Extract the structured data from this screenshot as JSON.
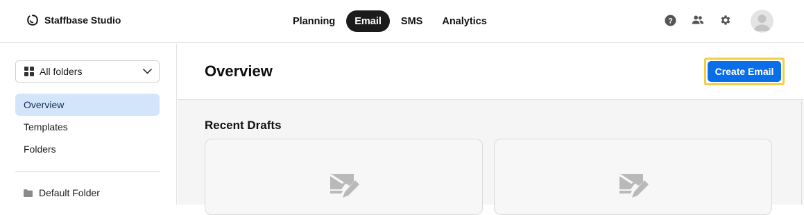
{
  "brand": {
    "name": "Staffbase Studio"
  },
  "nav": {
    "items": [
      {
        "label": "Planning",
        "active": false
      },
      {
        "label": "Email",
        "active": true
      },
      {
        "label": "SMS",
        "active": false
      },
      {
        "label": "Analytics",
        "active": false
      }
    ]
  },
  "top_icons": [
    "help-icon",
    "people-icon",
    "gear-icon"
  ],
  "sidebar": {
    "folder_select": {
      "label": "All folders"
    },
    "items": [
      {
        "label": "Overview",
        "active": true
      },
      {
        "label": "Templates",
        "active": false
      },
      {
        "label": "Folders",
        "active": false
      }
    ],
    "folders": [
      {
        "label": "Default Folder"
      }
    ]
  },
  "main": {
    "title": "Overview",
    "create_button": "Create Email",
    "recent_drafts": {
      "title": "Recent Drafts",
      "cards": [
        {
          "icon": "mail-edit-icon"
        },
        {
          "icon": "mail-edit-icon"
        }
      ]
    }
  },
  "colors": {
    "accent": "#0a6ee9",
    "active_nav_bg": "#1b1b1b",
    "sidebar_active_bg": "#d3e5fb",
    "highlight_border": "#f0cf42"
  }
}
